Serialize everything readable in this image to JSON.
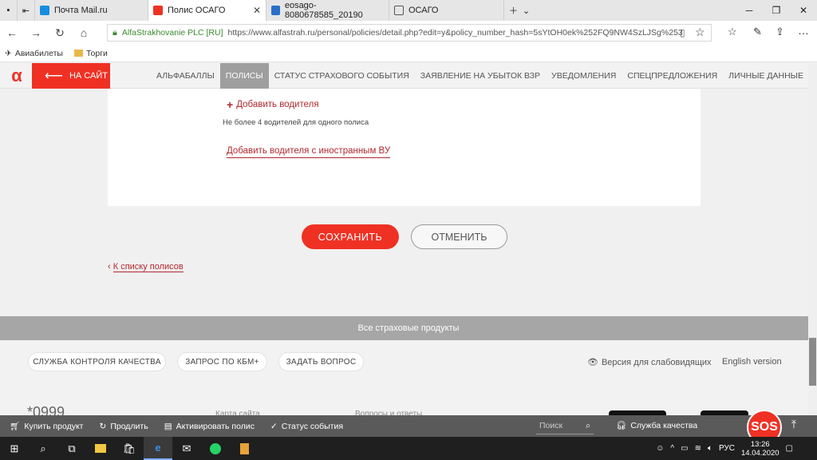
{
  "browser": {
    "tabs": [
      {
        "title": "Почта Mail.ru",
        "icon": "mail-icon"
      },
      {
        "title": "Полис ОСАГО",
        "icon": "alfa-icon"
      },
      {
        "title": "eosago-8080678585_20190",
        "icon": "pdf-icon"
      },
      {
        "title": "ОСАГО",
        "icon": "page-icon"
      }
    ],
    "address": {
      "site_name": "AlfaStrakhovanie PLC [RU]",
      "url": "https://www.alfastrah.ru/personal/policies/detail.php?edit=y&policy_number_hash=5sYtOH0ek%252FQ9NW4SzLJSg%253"
    },
    "favorites": [
      {
        "label": "Авиабилеты",
        "icon": "plane-icon"
      },
      {
        "label": "Торги",
        "icon": "folder-icon"
      }
    ]
  },
  "site": {
    "logo": "α",
    "back_label": "НА САЙТ",
    "nav": [
      {
        "label": "АЛЬФАБАЛЛЫ",
        "selected": false
      },
      {
        "label": "ПОЛИСЫ",
        "selected": true
      },
      {
        "label": "СТАТУС СТРАХОВОГО СОБЫТИЯ",
        "selected": false
      },
      {
        "label": "ЗАЯВЛЕНИЕ НА УБЫТОК ВЗР",
        "selected": false
      },
      {
        "label": "УВЕДОМЛЕНИЯ",
        "selected": false
      },
      {
        "label": "СПЕЦПРЕДЛОЖЕНИЯ",
        "selected": false
      },
      {
        "label": "ЛИЧНЫЕ ДАННЫЕ",
        "selected": false
      }
    ]
  },
  "form": {
    "add_driver": "Добавить водителя",
    "limit_note": "Не более 4 водителей для одного полиса",
    "add_foreign_driver": "Добавить водителя с иностранным ВУ",
    "save_label": "СОХРАНИТЬ",
    "cancel_label": "ОТМЕНИТЬ",
    "back_to_list": "К списку полисов"
  },
  "footer": {
    "all_products": "Все страховые продукты",
    "pills": [
      "СЛУЖБА КОНТРОЛЯ КАЧЕСТВА",
      "ЗАПРОС ПО КБМ+",
      "ЗАДАТЬ ВОПРОС"
    ],
    "vision_version": "Версия для слабовидящих",
    "english": "English version",
    "phone": "*0999",
    "sitemap": "Карта сайта",
    "faq": "Вопросы и ответы"
  },
  "action_bar": {
    "items": [
      {
        "label": "Купить продукт",
        "icon": "cart-icon"
      },
      {
        "label": "Продлить",
        "icon": "renew-icon"
      },
      {
        "label": "Активировать полис",
        "icon": "document-icon"
      },
      {
        "label": "Статус события",
        "icon": "check-circle-icon"
      }
    ],
    "search_placeholder": "Поиск",
    "quality": "Служба качества",
    "sos": "SOS"
  },
  "taskbar": {
    "lang": "РУС",
    "time": "13:26",
    "date": "14.04.2020"
  },
  "colors": {
    "brand": "#ef3124",
    "link": "#b2282f",
    "nav_selected": "#9e9e9e"
  }
}
